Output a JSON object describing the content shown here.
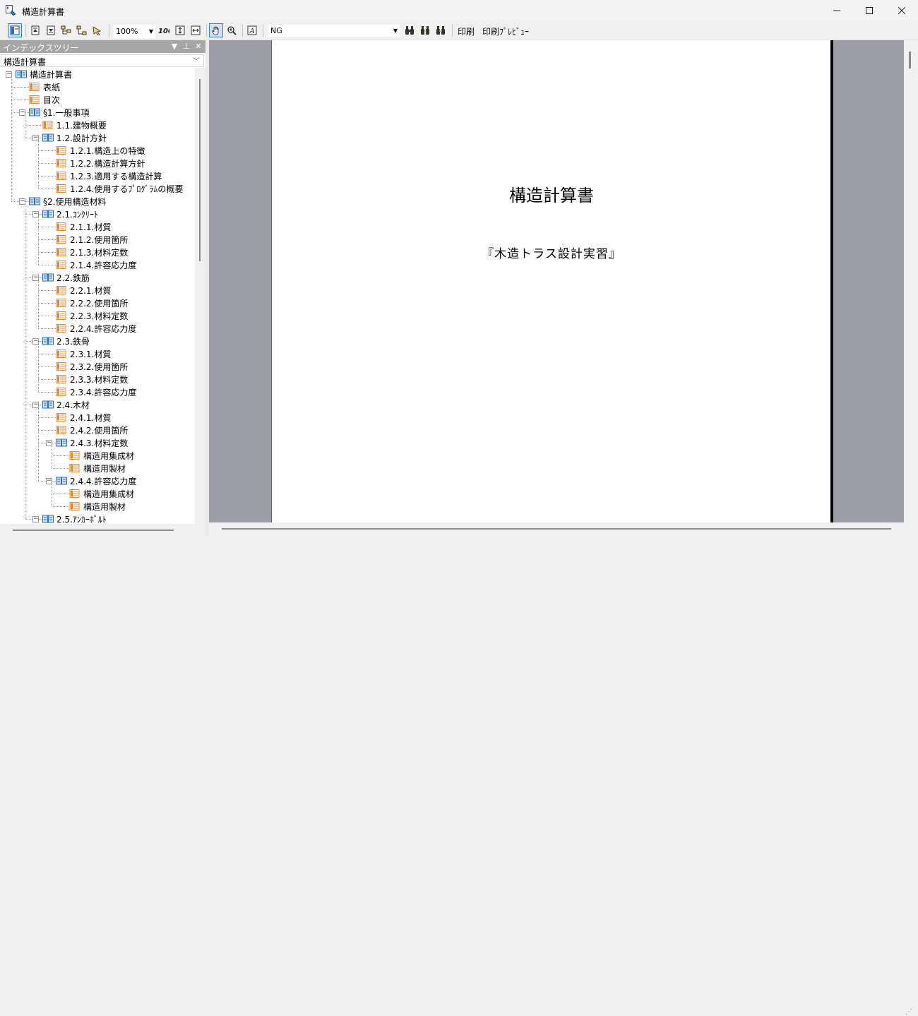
{
  "window": {
    "title": "構造計算書"
  },
  "toolbar": {
    "zoom": "100%",
    "search_value": "NG",
    "print_label": "印刷",
    "print_preview_label": "印刷ﾌﾟﾚﾋﾞｭｰ"
  },
  "index_pane": {
    "title": "インデックスツリー",
    "selector_value": "構造計算書"
  },
  "tree": [
    {
      "label": "構造計算書",
      "type": "book"
    },
    {
      "label": "表紙",
      "type": "page"
    },
    {
      "label": "目次",
      "type": "page"
    },
    {
      "label": "§1.一般事項",
      "type": "book"
    },
    {
      "label": "1.1.建物概要",
      "type": "page"
    },
    {
      "label": "1.2.設計方針",
      "type": "book"
    },
    {
      "label": "1.2.1.構造上の特徴",
      "type": "page"
    },
    {
      "label": "1.2.2.構造計算方針",
      "type": "page"
    },
    {
      "label": "1.2.3.適用する構造計算",
      "type": "page"
    },
    {
      "label": "1.2.4.使用するﾌﾟﾛｸﾞﾗﾑの概要",
      "type": "page"
    },
    {
      "label": "§2.使用構造材料",
      "type": "book"
    },
    {
      "label": "2.1.ｺﾝｸﾘｰﾄ",
      "type": "book"
    },
    {
      "label": "2.1.1.材質",
      "type": "page"
    },
    {
      "label": "2.1.2.使用箇所",
      "type": "page"
    },
    {
      "label": "2.1.3.材料定数",
      "type": "page"
    },
    {
      "label": "2.1.4.許容応力度",
      "type": "page"
    },
    {
      "label": "2.2.鉄筋",
      "type": "book"
    },
    {
      "label": "2.2.1.材質",
      "type": "page"
    },
    {
      "label": "2.2.2.使用箇所",
      "type": "page"
    },
    {
      "label": "2.2.3.材料定数",
      "type": "page"
    },
    {
      "label": "2.2.4.許容応力度",
      "type": "page"
    },
    {
      "label": "2.3.鉄骨",
      "type": "book"
    },
    {
      "label": "2.3.1.材質",
      "type": "page"
    },
    {
      "label": "2.3.2.使用箇所",
      "type": "page"
    },
    {
      "label": "2.3.3.材料定数",
      "type": "page"
    },
    {
      "label": "2.3.4.許容応力度",
      "type": "page"
    },
    {
      "label": "2.4.木材",
      "type": "book"
    },
    {
      "label": "2.4.1.材質",
      "type": "page"
    },
    {
      "label": "2.4.2.使用箇所",
      "type": "page"
    },
    {
      "label": "2.4.3.材料定数",
      "type": "book"
    },
    {
      "label": "構造用集成材",
      "type": "page"
    },
    {
      "label": "構造用製材",
      "type": "page"
    },
    {
      "label": "2.4.4.許容応力度",
      "type": "book"
    },
    {
      "label": "構造用集成材",
      "type": "page"
    },
    {
      "label": "構造用製材",
      "type": "page"
    },
    {
      "label": "2.5.ｱﾝｶｰﾎﾞﾙﾄ",
      "type": "book"
    }
  ],
  "document": {
    "title": "構造計算書",
    "subtitle": "『木造トラス設計実習』"
  },
  "colors": {
    "accent": "#3c7fd1",
    "page_icon": "#e8862a",
    "book_icon": "#2d6fb3",
    "workspace": "#9d9ea5"
  }
}
